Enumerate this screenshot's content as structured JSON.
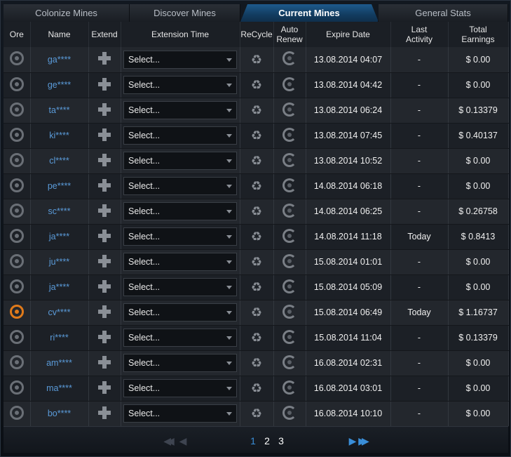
{
  "tabs": [
    {
      "label": "Colonize Mines"
    },
    {
      "label": "Discover Mines"
    },
    {
      "label": "Current Mines"
    },
    {
      "label": "General Stats"
    }
  ],
  "columns": {
    "ore": "Ore",
    "name": "Name",
    "extend": "Extend",
    "extension_time": "Extension Time",
    "recycle": "ReCycle",
    "auto_renew_1": "Auto",
    "auto_renew_2": "Renew",
    "expire_date": "Expire Date",
    "last_activity_1": "Last",
    "last_activity_2": "Activity",
    "total_earnings_1": "Total",
    "total_earnings_2": "Earnings"
  },
  "rows": [
    {
      "name": "ga****",
      "select": "Select...",
      "expire": "13.08.2014 04:07",
      "activity": "-",
      "earnings": "$ 0.00",
      "active": false
    },
    {
      "name": "ge****",
      "select": "Select...",
      "expire": "13.08.2014 04:42",
      "activity": "-",
      "earnings": "$ 0.00",
      "active": false
    },
    {
      "name": "ta****",
      "select": "Select...",
      "expire": "13.08.2014 06:24",
      "activity": "-",
      "earnings": "$ 0.13379",
      "active": false
    },
    {
      "name": "ki****",
      "select": "Select...",
      "expire": "13.08.2014 07:45",
      "activity": "-",
      "earnings": "$ 0.40137",
      "active": false
    },
    {
      "name": "cl****",
      "select": "Select...",
      "expire": "13.08.2014 10:52",
      "activity": "-",
      "earnings": "$ 0.00",
      "active": false
    },
    {
      "name": "pe****",
      "select": "Select...",
      "expire": "14.08.2014 06:18",
      "activity": "-",
      "earnings": "$ 0.00",
      "active": false
    },
    {
      "name": "sc****",
      "select": "Select...",
      "expire": "14.08.2014 06:25",
      "activity": "-",
      "earnings": "$ 0.26758",
      "active": false
    },
    {
      "name": "ja****",
      "select": "Select...",
      "expire": "14.08.2014 11:18",
      "activity": "Today",
      "earnings": "$ 0.8413",
      "active": false
    },
    {
      "name": "ju****",
      "select": "Select...",
      "expire": "15.08.2014 01:01",
      "activity": "-",
      "earnings": "$ 0.00",
      "active": false
    },
    {
      "name": "ja****",
      "select": "Select...",
      "expire": "15.08.2014 05:09",
      "activity": "-",
      "earnings": "$ 0.00",
      "active": false
    },
    {
      "name": "cv****",
      "select": "Select...",
      "expire": "15.08.2014 06:49",
      "activity": "Today",
      "earnings": "$ 1.16737",
      "active": true
    },
    {
      "name": "ri****",
      "select": "Select...",
      "expire": "15.08.2014 11:04",
      "activity": "-",
      "earnings": "$ 0.13379",
      "active": false
    },
    {
      "name": "am****",
      "select": "Select...",
      "expire": "16.08.2014 02:31",
      "activity": "-",
      "earnings": "$ 0.00",
      "active": false
    },
    {
      "name": "ma****",
      "select": "Select...",
      "expire": "16.08.2014 03:01",
      "activity": "-",
      "earnings": "$ 0.00",
      "active": false
    },
    {
      "name": "bo****",
      "select": "Select...",
      "expire": "16.08.2014 10:10",
      "activity": "-",
      "earnings": "$ 0.00",
      "active": false
    }
  ],
  "pagination": {
    "pages": [
      "1",
      "2",
      "3"
    ],
    "current": "1"
  },
  "colors": {
    "accent": "#3a8ed8",
    "active_ore": "#e07a1a",
    "name_link": "#5a9ad8"
  },
  "icons": {
    "ore": "ore-icon",
    "extend": "plus-icon",
    "recycle": "recycle-icon",
    "auto_renew": "renew-icon",
    "first_page": "double-chevron-left-icon",
    "prev_page": "chevron-left-icon",
    "next_page": "chevron-right-icon",
    "last_page": "double-chevron-right-icon"
  }
}
